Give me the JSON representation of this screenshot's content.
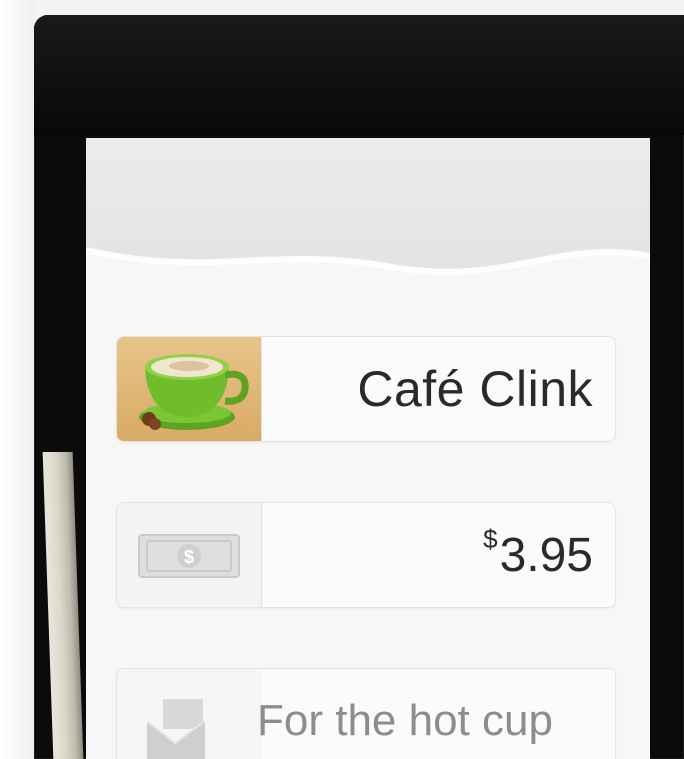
{
  "merchant": {
    "name": "Café Clink",
    "icon": "coffee-cup-icon"
  },
  "payment": {
    "currency_symbol": "$",
    "amount": "3.95",
    "icon": "cash-bill-icon"
  },
  "note": {
    "placeholder": "For the hot cup",
    "icon": "message-icon"
  },
  "colors": {
    "screen_bg": "#f7f7f7",
    "phone_bezel": "#0b0b0b",
    "cup_green": "#6fbd2b",
    "merchant_thumb_bg": "#d9aa64",
    "text_dark": "#2a2a2a",
    "text_placeholder": "#8d8d8d"
  }
}
